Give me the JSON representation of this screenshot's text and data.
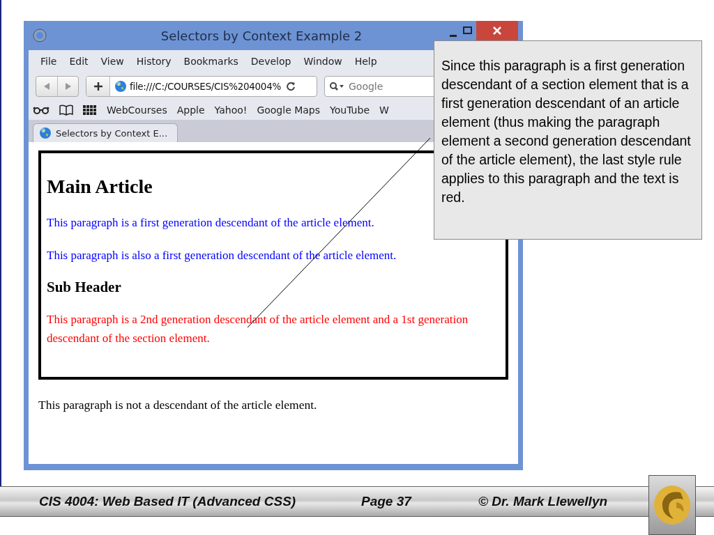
{
  "window": {
    "title": "Selectors by Context Example 2"
  },
  "menu": [
    "File",
    "Edit",
    "View",
    "History",
    "Bookmarks",
    "Develop",
    "Window",
    "Help"
  ],
  "toolbar": {
    "url": "file:///C:/COURSES/CIS%204004%",
    "search_placeholder": "Google"
  },
  "bookmarks": [
    "WebCourses",
    "Apple",
    "Yahoo!",
    "Google Maps",
    "YouTube",
    "W"
  ],
  "tabs": [
    {
      "label": "Selectors by Context E...",
      "selected": true
    }
  ],
  "article": [
    {
      "kind": "h1",
      "text": "Main Article"
    },
    {
      "kind": "p",
      "text": "This paragraph is a first generation descendant of the article element.",
      "color": "#0000ff"
    },
    {
      "kind": "p",
      "text": "This paragraph is also a first generation descendant of the article element.",
      "color": "#0000ff"
    },
    {
      "kind": "h2",
      "text": "Sub Header"
    },
    {
      "kind": "p",
      "text": "This paragraph is a 2nd generation descendant of the article element and a 1st generation descendant of the section element.",
      "color": "#ff0000"
    }
  ],
  "outside_paragraph": "This paragraph is not a descendant of the article element.",
  "callout": "Since this paragraph is a first generation descendant of a section element that is a first generation descendant of an article element (thus making the paragraph element a second generation descendant of the article element), the last style rule applies to this paragraph and the text is red.",
  "footer": {
    "course": "CIS 4004: Web Based IT (Advanced CSS)",
    "page": "Page 37",
    "author": "© Dr. Mark Llewellyn"
  }
}
